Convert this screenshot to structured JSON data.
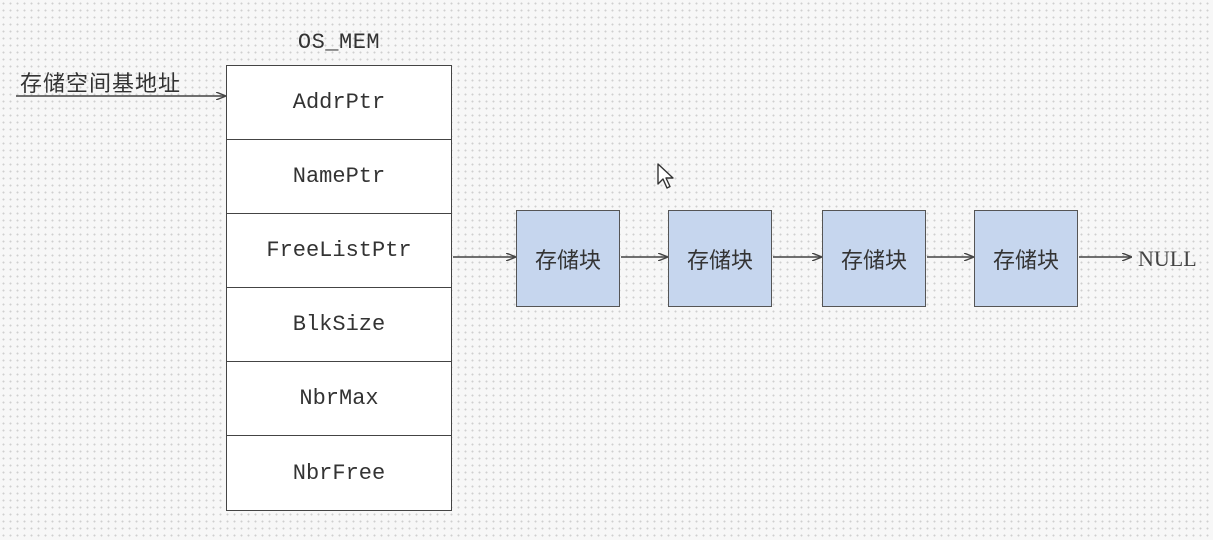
{
  "struct": {
    "title": "OS_MEM",
    "base_address_label": "存储空间基地址",
    "fields": [
      "AddrPtr",
      "NamePtr",
      "FreeListPtr",
      "BlkSize",
      "NbrMax",
      "NbrFree"
    ]
  },
  "free_list": {
    "blocks": [
      "存储块",
      "存储块",
      "存储块",
      "存储块"
    ],
    "terminator": "NULL"
  },
  "colors": {
    "block_fill": "#c6d6ee",
    "struct_fill": "#ffffff",
    "line": "#444444"
  }
}
